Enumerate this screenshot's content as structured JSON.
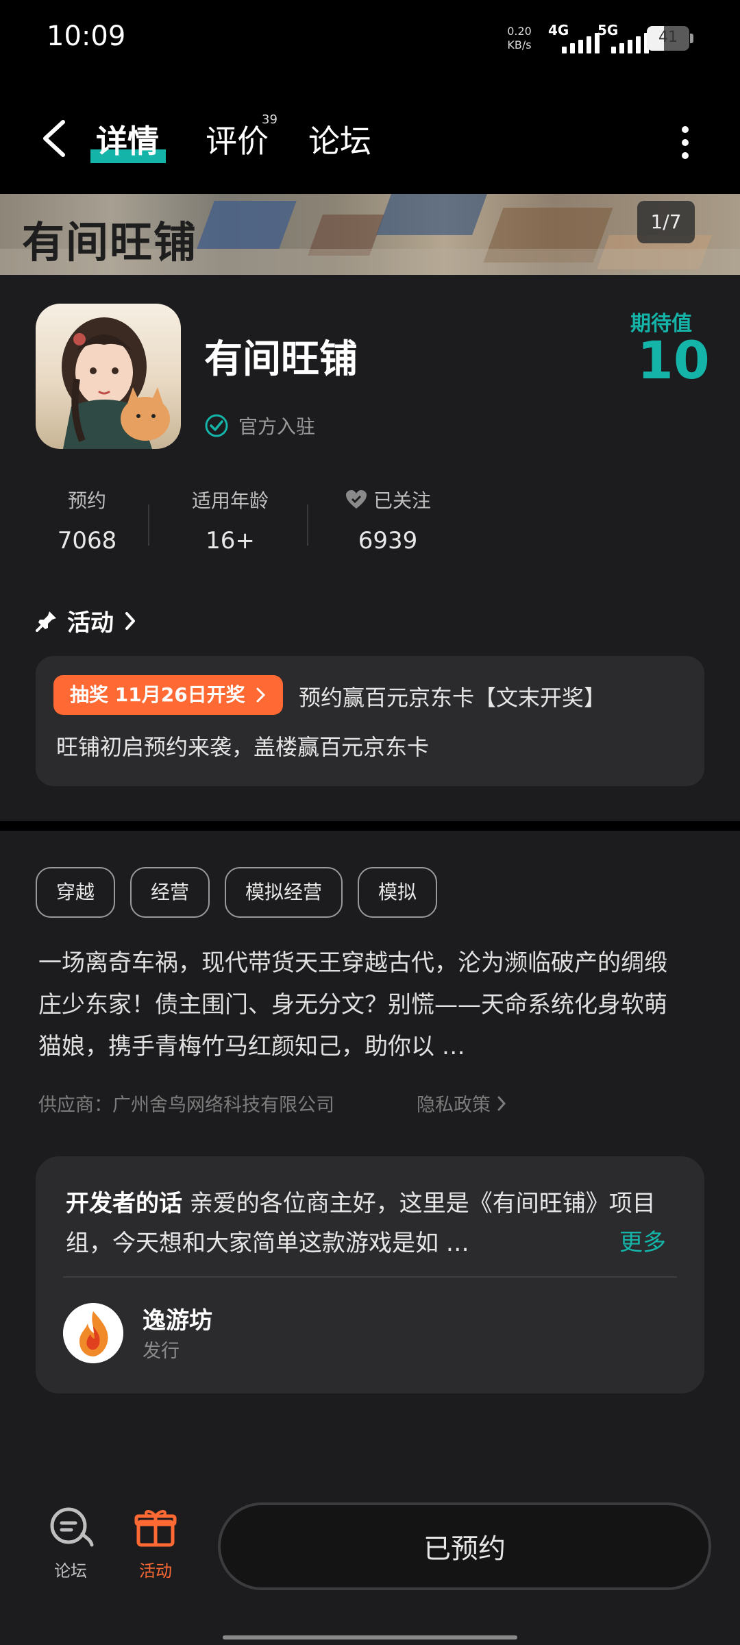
{
  "status_bar": {
    "time": "10:09",
    "net_speed_value": "0.20",
    "net_speed_unit": "KB/s",
    "sim1_label": "4G",
    "sim2_label": "5G",
    "battery_level": "41",
    "battery_fraction": 0.41
  },
  "header": {
    "tabs": [
      {
        "label": "详情",
        "active": true
      },
      {
        "label": "评价",
        "badge": "39"
      },
      {
        "label": "论坛"
      }
    ]
  },
  "banner": {
    "logo_text": "有间旺铺",
    "counter": "1/7"
  },
  "game": {
    "title": "有间旺铺",
    "verified_label": "官方入驻",
    "expect_label": "期待值",
    "expect_value": "10",
    "stats": [
      {
        "label": "预约",
        "value": "7068"
      },
      {
        "label": "适用年龄",
        "value": "16+"
      },
      {
        "label": "已关注",
        "value": "6939"
      }
    ]
  },
  "activity": {
    "section_title": "活动",
    "badge": "抽奖 11月26日开奖",
    "title": "预约赢百元京东卡【文末开奖】",
    "subtitle": "旺铺初启预约来袭，盖楼赢百元京东卡"
  },
  "tags": [
    "穿越",
    "经营",
    "模拟经营",
    "模拟"
  ],
  "description": "一场离奇车祸，现代带货天王穿越古代，沦为濒临破产的绸缎庄少东家！债主围门、身无分文？别慌——天命系统化身软萌猫娘，携手青梅竹马红颜知己，助你以 …",
  "supplier": "供应商：广州舍鸟网络科技有限公司",
  "privacy_label": "隐私政策",
  "developer": {
    "lead": "开发者的话",
    "text": "亲爱的各位商主好，这里是《有间旺铺》项目组，今天想和大家简单这款游戏是如 …",
    "more_label": "更多",
    "name": "逸游坊",
    "role": "发行"
  },
  "bottom_nav": {
    "forum_label": "论坛",
    "activity_label": "活动",
    "reserve_label": "已预约"
  },
  "colors": {
    "accent": "#14b5a8",
    "orange": "#ff6a34",
    "background": "#1c1c1e",
    "card": "#2b2b2d"
  }
}
